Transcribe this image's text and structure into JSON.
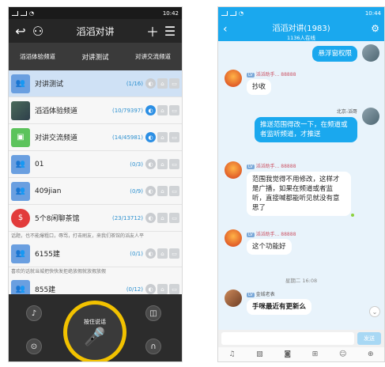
{
  "left": {
    "status": {
      "time": "10:42"
    },
    "header": {
      "title": "滔滔对讲"
    },
    "tabs": [
      "滔滔体验频道",
      "对讲测试",
      "对讲交流频道"
    ],
    "channels": [
      {
        "name": "对讲测试",
        "count": "(1/16)",
        "avatar": "blue"
      },
      {
        "name": "滔滔体验频道",
        "count": "(10/79397)",
        "avatar": "photo"
      },
      {
        "name": "对讲交流频道",
        "count": "(14/45981)",
        "avatar": "green"
      },
      {
        "name": "01",
        "count": "(0/3)",
        "avatar": "blue"
      },
      {
        "name": "409jian",
        "count": "(0/9)",
        "avatar": "blue"
      },
      {
        "name": "5个8闲聊茶馆",
        "count": "(23/13712)",
        "avatar": "red"
      },
      {
        "name": "6155建",
        "count": "(0/1)",
        "avatar": "blue"
      },
      {
        "name": "855建",
        "count": "(0/12)",
        "avatar": "blue"
      }
    ],
    "marquee1": "话题，也不能爆粗口，辱骂，打击刷友，来我们茶馆的滔友人平",
    "marquee2": "喜欢的话就当城把快快发拒绝放假就放假放假",
    "ptt_label": "按住说话"
  },
  "right": {
    "status": {
      "time": "10:44"
    },
    "header": {
      "title": "滔滔对讲(1983)",
      "subtitle": "1136人在线"
    },
    "messages": {
      "m1": "悬浮窗权限",
      "n1": "滔滔助手...  88888",
      "m2": "抄收",
      "n2": "北京-滔哥",
      "m3": "推送范围得改一下，在频道或者监听频道，才推送",
      "n3": "滔滔助手...  88888",
      "m4": "范围我觉得不用修改，这样才是广播，如果在频道或者监听，直接喊都能听见就没有意思了",
      "n4": "滔滔助手...  88888",
      "m5": "这个功能好",
      "time": "星期二 16:08",
      "n6": "金城老表",
      "m6": "手咪最近有更新么"
    },
    "send_label": "发送"
  }
}
